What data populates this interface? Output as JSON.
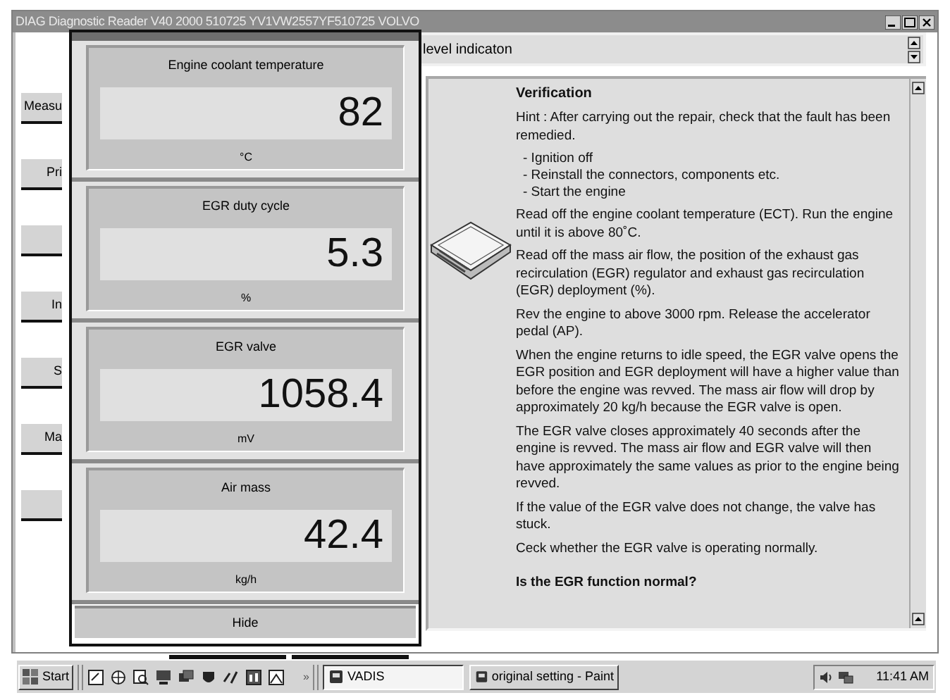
{
  "window": {
    "title": "DIAG Diagnostic Reader V40 2000 510725 YV1VW2557YF510725 VOLVO"
  },
  "side_buttons": [
    {
      "kind": "labeled",
      "label": "Measu"
    },
    {
      "kind": "labeled",
      "label": "Pri"
    },
    {
      "kind": "blank"
    },
    {
      "kind": "labeled",
      "label": "In"
    },
    {
      "kind": "labeled",
      "label": "S"
    },
    {
      "kind": "labeled",
      "label": "Ma"
    },
    {
      "kind": "blank"
    }
  ],
  "gauges": [
    {
      "title": "Engine coolant temperature",
      "value": "82",
      "unit": "°C"
    },
    {
      "title": "EGR duty cycle",
      "value": "5.3",
      "unit": "%"
    },
    {
      "title": "EGR valve",
      "value": "1058.4",
      "unit": "mV"
    },
    {
      "title": "Air mass",
      "value": "42.4",
      "unit": "kg/h"
    }
  ],
  "hide_button": "Hide",
  "header_field": "level indicaton",
  "document": {
    "heading": "Verification",
    "blocks": [
      {
        "kind": "text",
        "text": "Hint : After carrying out the repair, check that the fault has been remedied."
      },
      {
        "kind": "list",
        "items": [
          "- Ignition off",
          "- Reinstall the connectors, components etc.",
          "- Start the engine"
        ]
      },
      {
        "kind": "text",
        "text": "Read off the engine coolant temperature (ECT). Run the engine until it is above 80˚C."
      },
      {
        "kind": "text",
        "text": "Read off the mass air flow, the position of the exhaust gas recirculation (EGR) regulator and exhaust gas recirculation (EGR) deployment (%)."
      },
      {
        "kind": "text",
        "text": "Rev the engine to above 3000 rpm. Release the accelerator pedal (AP)."
      },
      {
        "kind": "text",
        "text": "When the engine returns to idle speed, the EGR valve opens the EGR position and EGR deployment will have a higher value than before the engine was revved. The mass air flow will drop by approximately 20 kg/h because the EGR valve is open."
      },
      {
        "kind": "text",
        "text": "The EGR valve closes approximately 40 seconds after the engine is revved. The mass air flow and EGR valve will then have approximately the same values as prior to the engine being revved."
      },
      {
        "kind": "text",
        "text": "If the value of the EGR valve does not change, the valve has stuck."
      },
      {
        "kind": "text",
        "text": "Ceck whether the EGR valve is operating normally."
      },
      {
        "kind": "question",
        "text": "Is the EGR function normal?"
      }
    ]
  },
  "taskbar": {
    "start": "Start",
    "more": "»",
    "tasks": [
      {
        "label": "VADIS",
        "selected": true
      },
      {
        "label": "original setting - Paint",
        "selected": false
      }
    ],
    "clock": "11:41 AM"
  }
}
